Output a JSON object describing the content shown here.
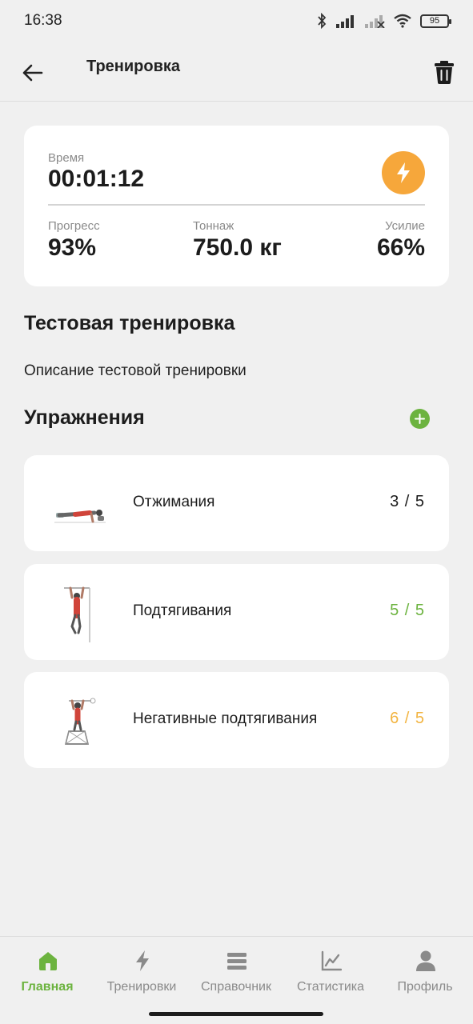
{
  "status_bar": {
    "time": "16:38",
    "battery": "95",
    "icons": [
      "bluetooth-icon",
      "signal-icon",
      "signal-off-icon",
      "wifi-icon",
      "battery-icon"
    ]
  },
  "app_bar": {
    "title": "Тренировка",
    "back_icon": "arrow-left-icon",
    "delete_icon": "trash-icon"
  },
  "stats": {
    "time_label": "Время",
    "time_value": "00:01:12",
    "progress_label": "Прогресс",
    "progress_value": "93%",
    "tonnage_label": "Тоннаж",
    "tonnage_value": "750.0 кг",
    "effort_label": "Усилие",
    "effort_value": "66%",
    "bolt_icon": "bolt-icon"
  },
  "workout": {
    "title": "Тестовая тренировка",
    "description": "Описание тестовой тренировки"
  },
  "exercises_section": {
    "title": "Упражнения",
    "add_icon": "plus-circle-icon"
  },
  "exercises": [
    {
      "name": "Отжимания",
      "count": "3 / 5",
      "count_color": "#1c1c1c",
      "thumb": "pushup-illustration"
    },
    {
      "name": "Подтягивания",
      "count": "5 / 5",
      "count_color": "#6cb33f",
      "thumb": "pullup-illustration"
    },
    {
      "name": "Негативные подтягивания",
      "count": "6 / 5",
      "count_color": "#f2b441",
      "thumb": "negative-pullup-illustration"
    }
  ],
  "bottom_nav": [
    {
      "label": "Главная",
      "icon": "home-icon",
      "active": true
    },
    {
      "label": "Тренировки",
      "icon": "bolt-icon",
      "active": false
    },
    {
      "label": "Справочник",
      "icon": "list-icon",
      "active": false
    },
    {
      "label": "Статистика",
      "icon": "chart-icon",
      "active": false
    },
    {
      "label": "Профиль",
      "icon": "user-icon",
      "active": false
    }
  ],
  "colors": {
    "accent": "#6cb33f",
    "orange": "#f6a73b",
    "background": "#f0f0f0",
    "card": "#ffffff"
  }
}
